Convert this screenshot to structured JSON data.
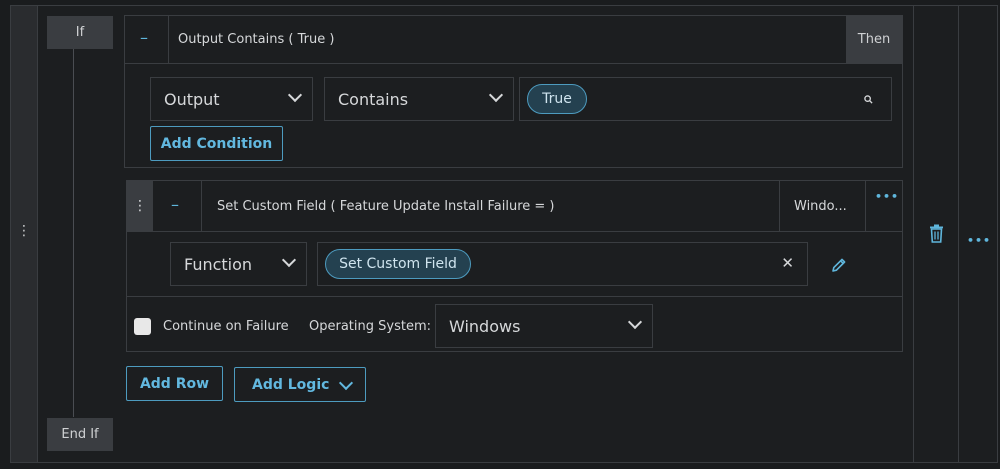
{
  "if_label": "If",
  "endif_label": "End If",
  "condition": {
    "title": "Output Contains ( True )",
    "then_label": "Then",
    "field_select": "Output",
    "operator_select": "Contains",
    "value_pill": "True",
    "add_condition_label": "Add Condition"
  },
  "action": {
    "title": "Set Custom Field ( Feature Update Install Failure = )",
    "os_short": "Windo...",
    "type_select": "Function",
    "function_pill": "Set Custom Field",
    "continue_label": "Continue on Failure",
    "os_label": "Operating System:",
    "os_select": "Windows"
  },
  "footer": {
    "add_row_label": "Add Row",
    "add_logic_label": "Add Logic"
  },
  "glyphs": {
    "minus": "–",
    "vertical_dots": "⋮",
    "horizontal_dots": "•••",
    "close": "✕"
  },
  "colors": {
    "accent": "#5fb6dc",
    "pill_bg": "#244150",
    "panel": "#3a3d41"
  }
}
